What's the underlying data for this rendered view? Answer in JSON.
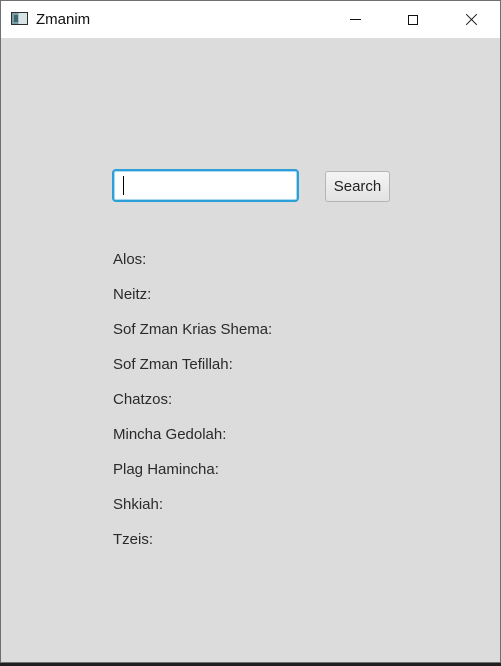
{
  "window": {
    "title": "Zmanim",
    "icon": "app-window-icon",
    "controls": [
      "minimize-icon",
      "maximize-icon",
      "close-icon"
    ]
  },
  "search": {
    "value": "",
    "placeholder": "",
    "button_label": "Search"
  },
  "zmanim": [
    {
      "label": "Alos:"
    },
    {
      "label": "Neitz:"
    },
    {
      "label": "Sof Zman Krias Shema:"
    },
    {
      "label": "Sof Zman Tefillah:"
    },
    {
      "label": "Chatzos:"
    },
    {
      "label": "Mincha Gedolah:"
    },
    {
      "label": "Plag Hamincha:"
    },
    {
      "label": "Shkiah:"
    },
    {
      "label": "Tzeis:"
    }
  ],
  "colors": {
    "background": "#dcdcdc",
    "titlebar": "#ffffff",
    "focus_border": "#2d9fd8"
  }
}
